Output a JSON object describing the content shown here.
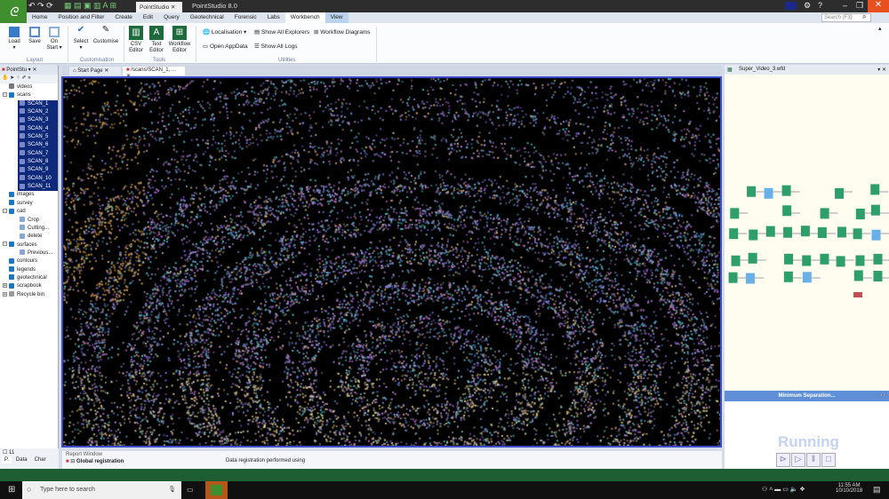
{
  "titlebar": {
    "doc_tab": "PointStudio",
    "app_title": "PointStudio 8.0",
    "search_placeholder": "Search (F3)"
  },
  "menu": [
    "Home",
    "Position and Filter",
    "Create",
    "Edit",
    "Query",
    "Geotechnical",
    "Forensic",
    "Labs",
    "Workbench",
    "View"
  ],
  "ribbon": {
    "load": "Load",
    "save": "Save",
    "on_start": "On Start",
    "select": "Select",
    "customise": "Customise",
    "csv_editor": "CSV Editor",
    "text_editor": "Text Editor",
    "workflow_editor": "Workflow Editor",
    "localisation": "Localisation",
    "open_appdata": "Open AppData",
    "show_all_explorers": "Show All Explorers",
    "show_all_logs": "Show All Logs",
    "workflow_diagrams": "Workflow Diagrams",
    "groups": {
      "layout": "Layout",
      "customisation": "Customisation",
      "tools": "Tools",
      "utilities": "Utilities"
    }
  },
  "left_panel": {
    "title": "PointStu",
    "footer_count": "11",
    "footer_tabs": [
      "P.",
      "Data",
      "Char"
    ],
    "tree": [
      {
        "label": "videos",
        "level": 0,
        "type": "file"
      },
      {
        "label": "scans",
        "level": 0,
        "type": "folder",
        "exp": "-"
      },
      {
        "label": "SCAN_1",
        "level": 1,
        "type": "scan",
        "sel": true
      },
      {
        "label": "SCAN_2",
        "level": 1,
        "type": "scan",
        "sel": true
      },
      {
        "label": "SCAN_3",
        "level": 1,
        "type": "scan",
        "sel": true
      },
      {
        "label": "SCAN_4",
        "level": 1,
        "type": "scan",
        "sel": true
      },
      {
        "label": "SCAN_5",
        "level": 1,
        "type": "scan",
        "sel": true
      },
      {
        "label": "SCAN_6",
        "level": 1,
        "type": "scan",
        "sel": true
      },
      {
        "label": "SCAN_7",
        "level": 1,
        "type": "scan",
        "sel": true
      },
      {
        "label": "SCAN_8",
        "level": 1,
        "type": "scan",
        "sel": true
      },
      {
        "label": "SCAN_9",
        "level": 1,
        "type": "scan",
        "sel": true
      },
      {
        "label": "SCAN_10",
        "level": 1,
        "type": "scan",
        "sel": true
      },
      {
        "label": "SCAN_11",
        "level": 1,
        "type": "scan",
        "sel": true
      },
      {
        "label": "images",
        "level": 0,
        "type": "folder"
      },
      {
        "label": "survey",
        "level": 0,
        "type": "folder"
      },
      {
        "label": "cad",
        "level": 0,
        "type": "folder",
        "exp": "-"
      },
      {
        "label": "Crop",
        "level": 1,
        "type": "item"
      },
      {
        "label": "Cutting...",
        "level": 1,
        "type": "item"
      },
      {
        "label": "delete",
        "level": 1,
        "type": "item"
      },
      {
        "label": "surfaces",
        "level": 0,
        "type": "folder",
        "exp": "-"
      },
      {
        "label": "Previous...",
        "level": 1,
        "type": "item"
      },
      {
        "label": "contours",
        "level": 0,
        "type": "folder"
      },
      {
        "label": "legends",
        "level": 0,
        "type": "folder"
      },
      {
        "label": "geotechnical",
        "level": 0,
        "type": "folder"
      },
      {
        "label": "scrapbook",
        "level": 0,
        "type": "folder",
        "exp": "+"
      },
      {
        "label": "Recycle bin",
        "level": 0,
        "type": "bin",
        "exp": "+"
      }
    ]
  },
  "doc_tabs": [
    "Start Page",
    "/scans/SCAN_1, ..."
  ],
  "right_panel": {
    "title": "Super_Video_3.wfd",
    "status_bar": "Minimum Separation...",
    "state": "Running"
  },
  "report": {
    "title": "Report Window",
    "row_label": "Global registration",
    "row_message": "Data registration performed using"
  },
  "taskbar": {
    "search_placeholder": "Type here to search",
    "time": "11:55 AM",
    "date": "10/10/2018"
  },
  "colors": {
    "accent": "#3f8f2f",
    "selection": "#0f2a7a",
    "viewer_border": "#3a4cc9",
    "close": "#e8501f"
  }
}
